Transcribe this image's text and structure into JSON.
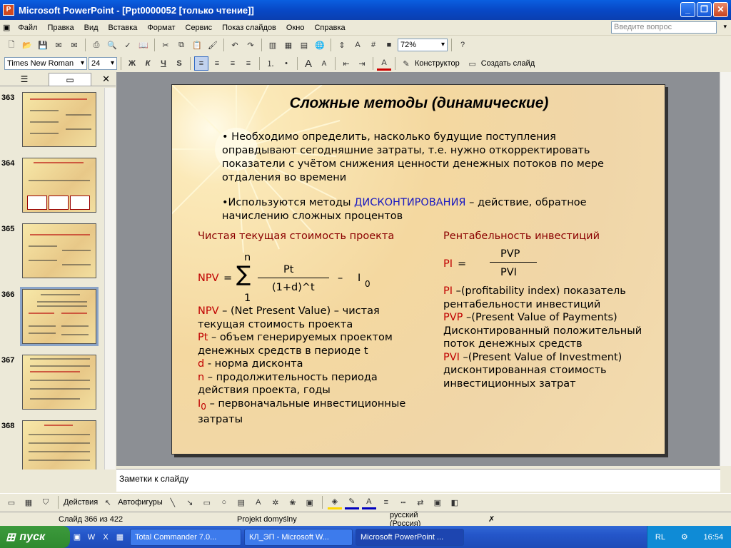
{
  "window": {
    "title": "Microsoft PowerPoint - [Ppt0000052 [только чтение]]",
    "minimize": "_",
    "restore": "❐",
    "close": "✕"
  },
  "menu": {
    "items": [
      "Файл",
      "Правка",
      "Вид",
      "Вставка",
      "Формат",
      "Сервис",
      "Показ слайдов",
      "Окно",
      "Справка"
    ],
    "ask_placeholder": "Введите вопрос"
  },
  "toolbar": {
    "zoom": "72%",
    "font": "Times New Roman",
    "size": "24",
    "bold": "Ж",
    "italic": "К",
    "underline": "Ч",
    "shadow": "S",
    "designer": "Конструктор",
    "new_slide": "Создать слайд"
  },
  "pane": {
    "thumbs": [
      "363",
      "364",
      "365",
      "366",
      "367",
      "368"
    ],
    "selected": "366"
  },
  "slide": {
    "title": "Сложные методы (динамические)",
    "bullet1": "• Необходимо определить, насколько будущие поступления оправдывают сегодняшние затраты, т.е. нужно откорректировать показатели с учётом снижения ценности денежных потоков по мере отдаления во времени",
    "bullet2_pre": "•Используются методы ",
    "bullet2_hl": "ДИСКОНТИРОВАНИЯ",
    "bullet2_post": " – действие, обратное начислению сложных процентов",
    "left_header": "Чистая текущая стоимость проекта",
    "right_header": "Рентабельность инвестиций",
    "formula_n": "n",
    "formula_npv": "NPV",
    "formula_eq": " = ",
    "formula_num": "Pt",
    "formula_den": "(1+d)^t",
    "formula_minus": "–",
    "formula_i": "I",
    "formula_i_sub": "0",
    "formula_1": "1",
    "pi_label": "PI",
    "pi_eq": "=",
    "pi_num": "PVP",
    "pi_den": "PVI",
    "left_defs": [
      {
        "k": "NPV",
        "v": " – (Net Present Value) – чистая текущая стоимость проекта"
      },
      {
        "k": "Pt",
        "v": " – объем генерируемых проектом денежных средств в периоде t"
      },
      {
        "k": "d",
        "v": "  - норма дисконта"
      },
      {
        "k": "n",
        "v": " – продолжительность периода действия проекта, годы"
      },
      {
        "k": "I",
        "sub": "0",
        "v": " – первоначальные инвестиционные затраты"
      }
    ],
    "right_defs": [
      {
        "k": "PI",
        "v": " –(profitability index) показатель рентабельности инвестиций"
      },
      {
        "k": "PVP",
        "v": " –(Present Value of Payments) Дисконтированный положительный поток денежных средств"
      },
      {
        "k": "PVI",
        "v": " –(Present Value of Investment) дисконтированная стоимость инвестиционных затрат"
      }
    ]
  },
  "notes": {
    "placeholder": "Заметки к слайду"
  },
  "drawbar": {
    "actions": "Действия",
    "autoshapes": "Автофигуры"
  },
  "status": {
    "slide": "Слайд 366 из 422",
    "design": "Projekt domyślny",
    "lang": "русский (Россия)"
  },
  "taskbar": {
    "start": "пуск",
    "tasks": [
      "Total Commander 7.0...",
      "КЛ_ЭП - Microsoft W...",
      "Microsoft PowerPoint ..."
    ],
    "lang": "RL",
    "time": "16:54"
  },
  "colors": {
    "accent_red": "#c00000",
    "header_red": "#8b0000",
    "highlight_blue": "#1a1ac0"
  }
}
